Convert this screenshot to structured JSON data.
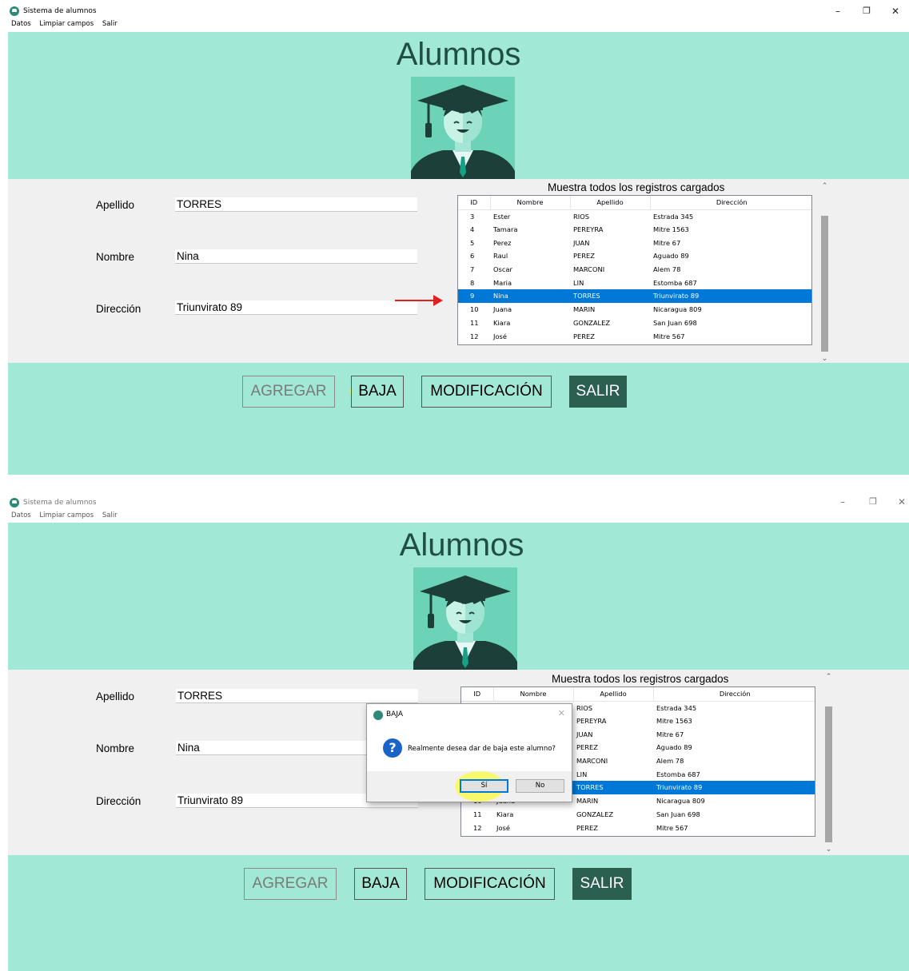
{
  "window": {
    "title": "Sistema de alumnos",
    "min_glyph": "–",
    "max_glyph": "❐",
    "close_glyph": "✕"
  },
  "menu": [
    "Datos",
    "Limpiar campos",
    "Salir"
  ],
  "header": {
    "title": "Alumnos",
    "avatar_icon": "graduate-avatar-icon"
  },
  "form": {
    "apellido_label": "Apellido",
    "apellido_value": "TORRES",
    "nombre_label": "Nombre",
    "nombre_value": "Nina",
    "direccion_label": "Dirección",
    "direccion_value": "Triunvirato 89"
  },
  "grid": {
    "caption": "Muestra todos los registros cargados",
    "columns": [
      "ID",
      "Nombre",
      "Apellido",
      "Dirección"
    ],
    "rows": [
      [
        "3",
        "Ester",
        "RIOS",
        "Estrada 345"
      ],
      [
        "4",
        "Tamara",
        "PEREYRA",
        "Mitre 1563"
      ],
      [
        "5",
        "Perez",
        "JUAN",
        "Mitre 67"
      ],
      [
        "6",
        "Raul",
        "PEREZ",
        "Aguado 89"
      ],
      [
        "7",
        "Oscar",
        "MARCONI",
        "Alem 78"
      ],
      [
        "8",
        "Maria",
        "LIN",
        "Estomba 687"
      ],
      [
        "9",
        "Nina",
        "TORRES",
        "Triunvirato 89"
      ],
      [
        "10",
        "Juana",
        "MARIN",
        "Nicaragua 809"
      ],
      [
        "11",
        "Kiara",
        "GONZALEZ",
        "San Juan 698"
      ],
      [
        "12",
        "José",
        "PEREZ",
        "Mitre 567"
      ]
    ],
    "selected_id": "9"
  },
  "buttons": {
    "agregar": "AGREGAR",
    "baja": "BAJA",
    "modificacion": "MODIFICACIÓN",
    "salir": "SALIR"
  },
  "dialog": {
    "title": "BAJA",
    "message": "Realmente desea dar de baja este alumno?",
    "yes": "Sí",
    "no": "No",
    "close_glyph": "✕",
    "icon": "question-icon"
  },
  "colors": {
    "header_bg": "#a1e8d6",
    "salir_bg": "#2b5f50",
    "selection": "#0078d7",
    "highlight": "#ffff00",
    "arrow": "#e02020"
  }
}
